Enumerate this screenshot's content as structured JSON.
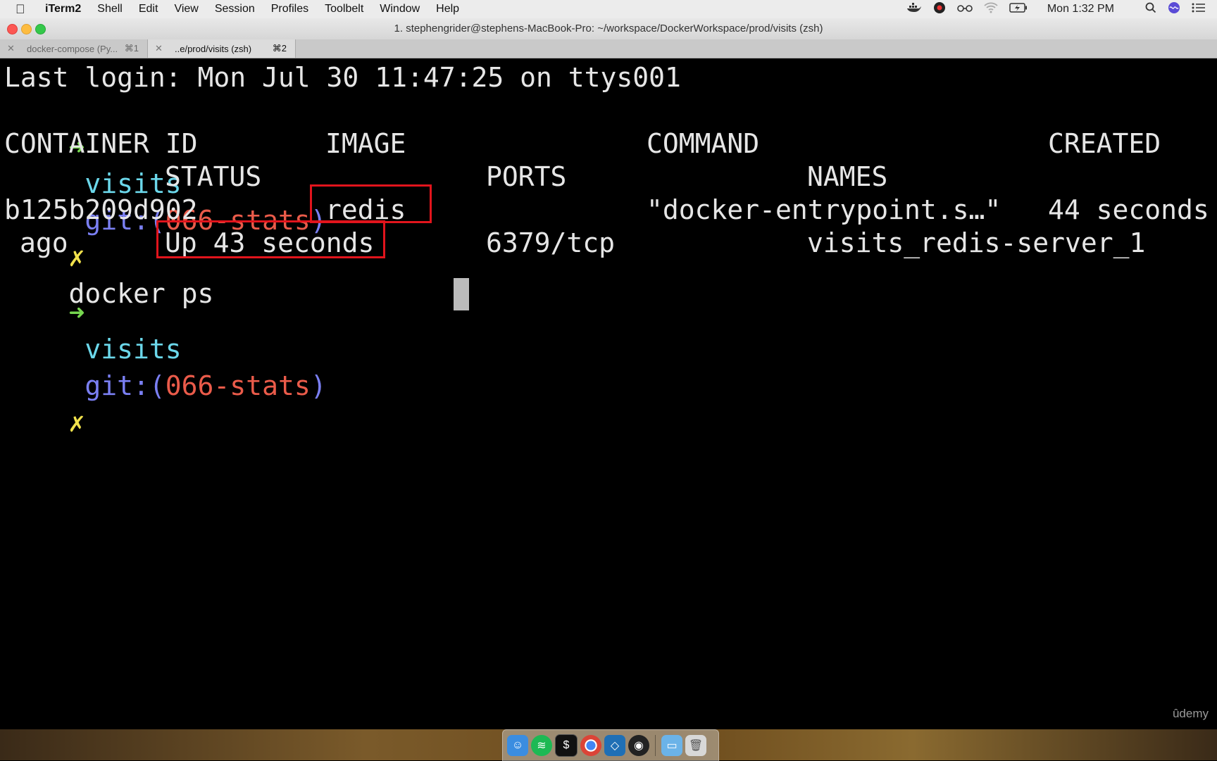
{
  "menubar": {
    "apple_icon": "apple-icon",
    "app_name": "iTerm2",
    "items": [
      "Shell",
      "Edit",
      "View",
      "Session",
      "Profiles",
      "Toolbelt",
      "Window",
      "Help"
    ],
    "clock": "Mon 1:32 PM"
  },
  "window": {
    "title": "1. stephengrider@stephens-MacBook-Pro: ~/workspace/DockerWorkspace/prod/visits (zsh)"
  },
  "tabs": [
    {
      "label": "docker-compose (Py...",
      "shortcut": "⌘1",
      "active": false
    },
    {
      "label": "..e/prod/visits (zsh)",
      "shortcut": "⌘2",
      "active": true
    }
  ],
  "terminal": {
    "last_login": "Last login: Mon Jul 30 11:47:25 on ttys001",
    "prompt": {
      "arrow": "➜",
      "dir": "visits",
      "git_open": "git:(",
      "branch": "066-stats",
      "git_close": ")",
      "dirty": "✗"
    },
    "command": "docker ps",
    "headers": {
      "container_id": "CONTAINER ID",
      "image": "IMAGE",
      "command": "COMMAND",
      "created": "CREATED",
      "status": "STATUS",
      "ports": "PORTS",
      "names": "NAMES"
    },
    "row": {
      "container_id": "b125b209d902",
      "image": "redis",
      "command": "\"docker-entrypoint.s…\"",
      "created": "44 seconds",
      "created_cont": "ago",
      "status": "Up 43 seconds",
      "ports": "6379/tcp",
      "names": "visits_redis-server_1"
    },
    "highlight_color": "#e1141c"
  },
  "watermark": "ûdemy",
  "colors": {
    "arrow": "#76d64f",
    "dir": "#6bd7ea",
    "git": "#7a7ff2",
    "branch": "#ea5b4a",
    "dirty": "#f2e24c"
  }
}
